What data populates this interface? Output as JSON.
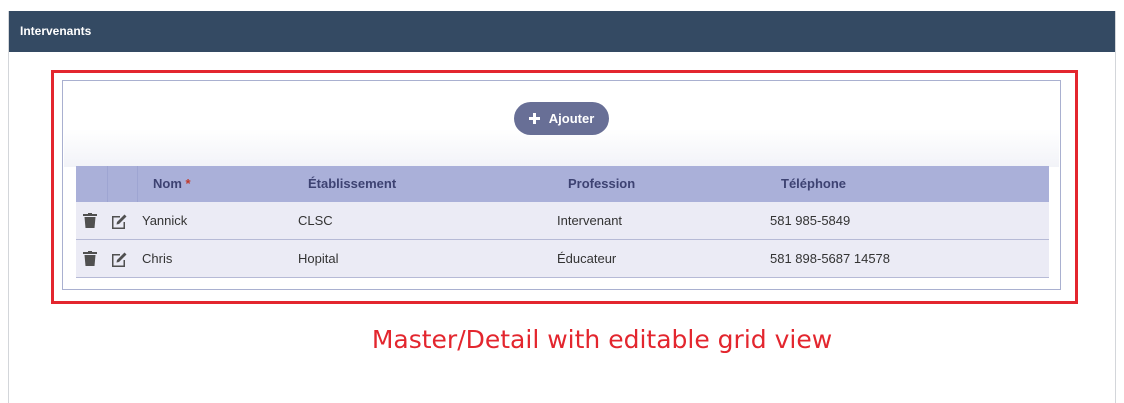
{
  "panel": {
    "title": "Intervenants"
  },
  "add_button": {
    "label": "Ajouter"
  },
  "grid": {
    "columns": [
      {
        "label": "Nom",
        "required_mark": "*"
      },
      {
        "label": "Établissement"
      },
      {
        "label": "Profession"
      },
      {
        "label": "Téléphone"
      }
    ],
    "rows": [
      {
        "nom": "Yannick",
        "etablissement": "CLSC",
        "profession": "Intervenant",
        "telephone": "581 985-5849"
      },
      {
        "nom": "Chris",
        "etablissement": "Hopital",
        "profession": "Éducateur",
        "telephone": "581 898-5687 14578"
      }
    ]
  },
  "caption": "Master/Detail with editable grid view",
  "colors": {
    "header_bg": "#344a63",
    "button_bg": "#686f96",
    "grid_header_bg": "#aab0d9",
    "row_bg": "#ebebf5",
    "highlight": "#e3262e"
  },
  "icons": [
    "plus-icon",
    "trash-icon",
    "edit-icon"
  ]
}
